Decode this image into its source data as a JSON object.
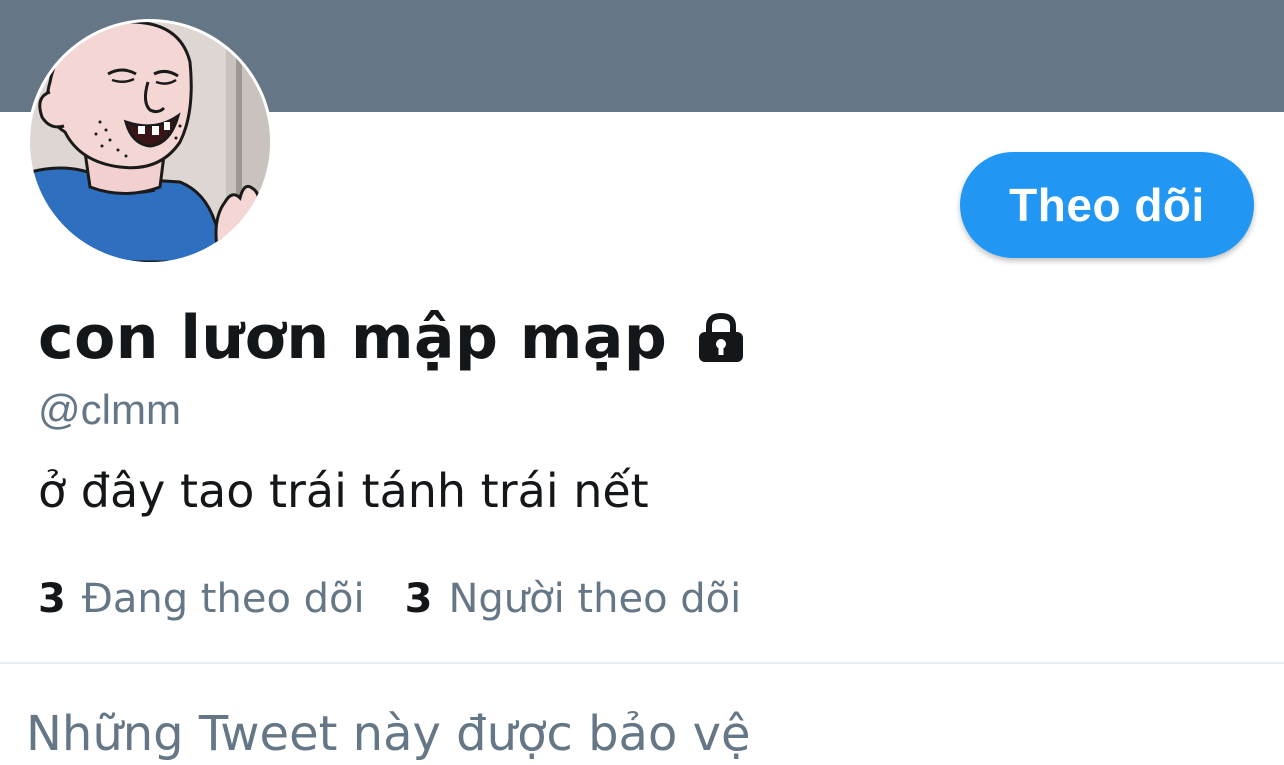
{
  "profile": {
    "display_name": "con lươn mập mạp",
    "handle": "@clmm",
    "bio": "ở đây tao trái tánh trái nết",
    "follow_button_label": "Theo dõi",
    "lock_icon": "lock-icon",
    "avatar_icon": "cartoon-man-avatar"
  },
  "stats": {
    "following_count": "3",
    "following_label": "Đang theo dõi",
    "followers_count": "3",
    "followers_label": "Người theo dõi"
  },
  "tweets": {
    "protected_message": "Những Tweet này được bảo vệ"
  },
  "colors": {
    "banner": "#657786",
    "accent": "#2196f3",
    "text_primary": "#14171a",
    "text_secondary": "#657786"
  }
}
